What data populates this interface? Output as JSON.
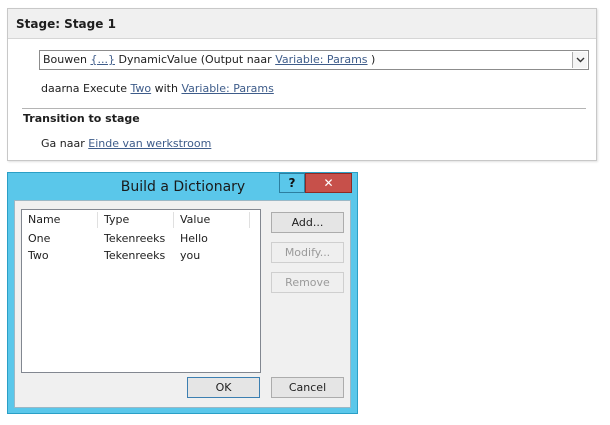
{
  "stage": {
    "title": "Stage: Stage 1",
    "action": {
      "verb": "Bouwen",
      "dict_link": "{...}",
      "middle": "DynamicValue (Output naar",
      "var_link": "Variable: Params",
      "close": ")"
    },
    "execute": {
      "prefix": "daarna Execute",
      "target_link": "Two",
      "with": "with",
      "var_link": "Variable: Params"
    },
    "transition_title": "Transition to stage",
    "goto": {
      "prefix": "Ga naar",
      "target_link": "Einde van werkstroom"
    }
  },
  "dialog": {
    "title": "Build a Dictionary",
    "help_label": "?",
    "close_label": "✕",
    "columns": [
      "Name",
      "Type",
      "Value"
    ],
    "rows": [
      {
        "name": "One",
        "type": "Tekenreeks",
        "value": "Hello"
      },
      {
        "name": "Two",
        "type": "Tekenreeks",
        "value": "you"
      }
    ],
    "buttons": {
      "add": "Add...",
      "modify": "Modify...",
      "remove": "Remove",
      "ok": "OK",
      "cancel": "Cancel"
    }
  }
}
